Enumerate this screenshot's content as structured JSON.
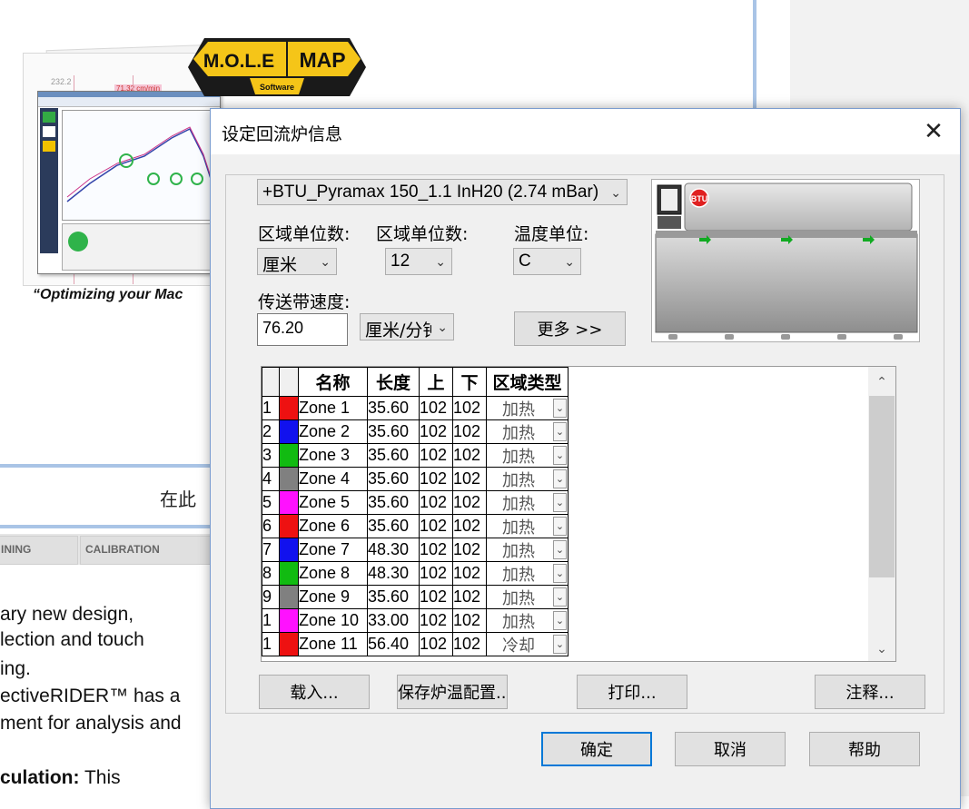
{
  "background": {
    "promo": {
      "logo_left": "M.O.L.E",
      "logo_right": "MAP",
      "logo_sub": "Software",
      "tagline": "“Optimizing your Mac",
      "paper_page_number": "232.2",
      "paper_tag": "71.32 cm/min"
    },
    "partial_heading": "在此",
    "tabs": [
      "INING",
      "CALIBRATION"
    ],
    "text_lines": [
      {
        "text": "ary new design,",
        "bold_prefix": ""
      },
      {
        "text": "lection and touch",
        "bold_prefix": ""
      },
      {
        "text": "ing.",
        "bold_prefix": ""
      },
      {
        "text": "ectiveRIDER™ has a",
        "bold_prefix": ""
      },
      {
        "text": "ment for analysis and",
        "bold_prefix": ""
      },
      {
        "text": " This",
        "bold_prefix": "culation:"
      }
    ]
  },
  "dialog": {
    "title": "设定回流炉信息",
    "close_glyph": "✕",
    "oven_model": "+BTU_Pyramax 150_1.1 InH20 (2.74 mBar)",
    "labels": {
      "zone_unit_a": "区域单位数:",
      "zone_unit_b": "区域单位数:",
      "temp_unit": "温度单位:",
      "belt_speed": "传送带速度:"
    },
    "zone_unit_value": "厘米",
    "zone_count_value": "12",
    "temp_unit_value": "C",
    "belt_speed_value": "76.20",
    "speed_unit_value": "厘米/分钟",
    "more_button": "更多 >>",
    "oven_logo": "BTU",
    "columns": [
      "",
      "",
      "名称",
      "长度",
      "上",
      "下",
      "区域类型"
    ],
    "zones": [
      {
        "num": "1",
        "color": "#ee1111",
        "name": "Zone 1",
        "length": "35.60",
        "top": "102",
        "bottom": "102",
        "type": "加热"
      },
      {
        "num": "2",
        "color": "#1111ee",
        "name": "Zone 2",
        "length": "35.60",
        "top": "102",
        "bottom": "102",
        "type": "加热"
      },
      {
        "num": "3",
        "color": "#11bb11",
        "name": "Zone 3",
        "length": "35.60",
        "top": "102",
        "bottom": "102",
        "type": "加热"
      },
      {
        "num": "4",
        "color": "#808080",
        "name": "Zone 4",
        "length": "35.60",
        "top": "102",
        "bottom": "102",
        "type": "加热"
      },
      {
        "num": "5",
        "color": "#ff11ff",
        "name": "Zone 5",
        "length": "35.60",
        "top": "102",
        "bottom": "102",
        "type": "加热"
      },
      {
        "num": "6",
        "color": "#ee1111",
        "name": "Zone 6",
        "length": "35.60",
        "top": "102",
        "bottom": "102",
        "type": "加热"
      },
      {
        "num": "7",
        "color": "#1111ee",
        "name": "Zone 7",
        "length": "48.30",
        "top": "102",
        "bottom": "102",
        "type": "加热"
      },
      {
        "num": "8",
        "color": "#11bb11",
        "name": "Zone 8",
        "length": "48.30",
        "top": "102",
        "bottom": "102",
        "type": "加热"
      },
      {
        "num": "9",
        "color": "#808080",
        "name": "Zone 9",
        "length": "35.60",
        "top": "102",
        "bottom": "102",
        "type": "加热"
      },
      {
        "num": "1",
        "color": "#ff11ff",
        "name": "Zone 10",
        "length": "33.00",
        "top": "102",
        "bottom": "102",
        "type": "加热"
      },
      {
        "num": "1",
        "color": "#ee1111",
        "name": "Zone 11",
        "length": "56.40",
        "top": "102",
        "bottom": "102",
        "type": "冷却"
      }
    ],
    "buttons": {
      "load": "载入...",
      "save": "保存炉温配置...",
      "print": "打印...",
      "notes": "注释...",
      "ok": "确定",
      "cancel": "取消",
      "help": "帮助"
    }
  }
}
